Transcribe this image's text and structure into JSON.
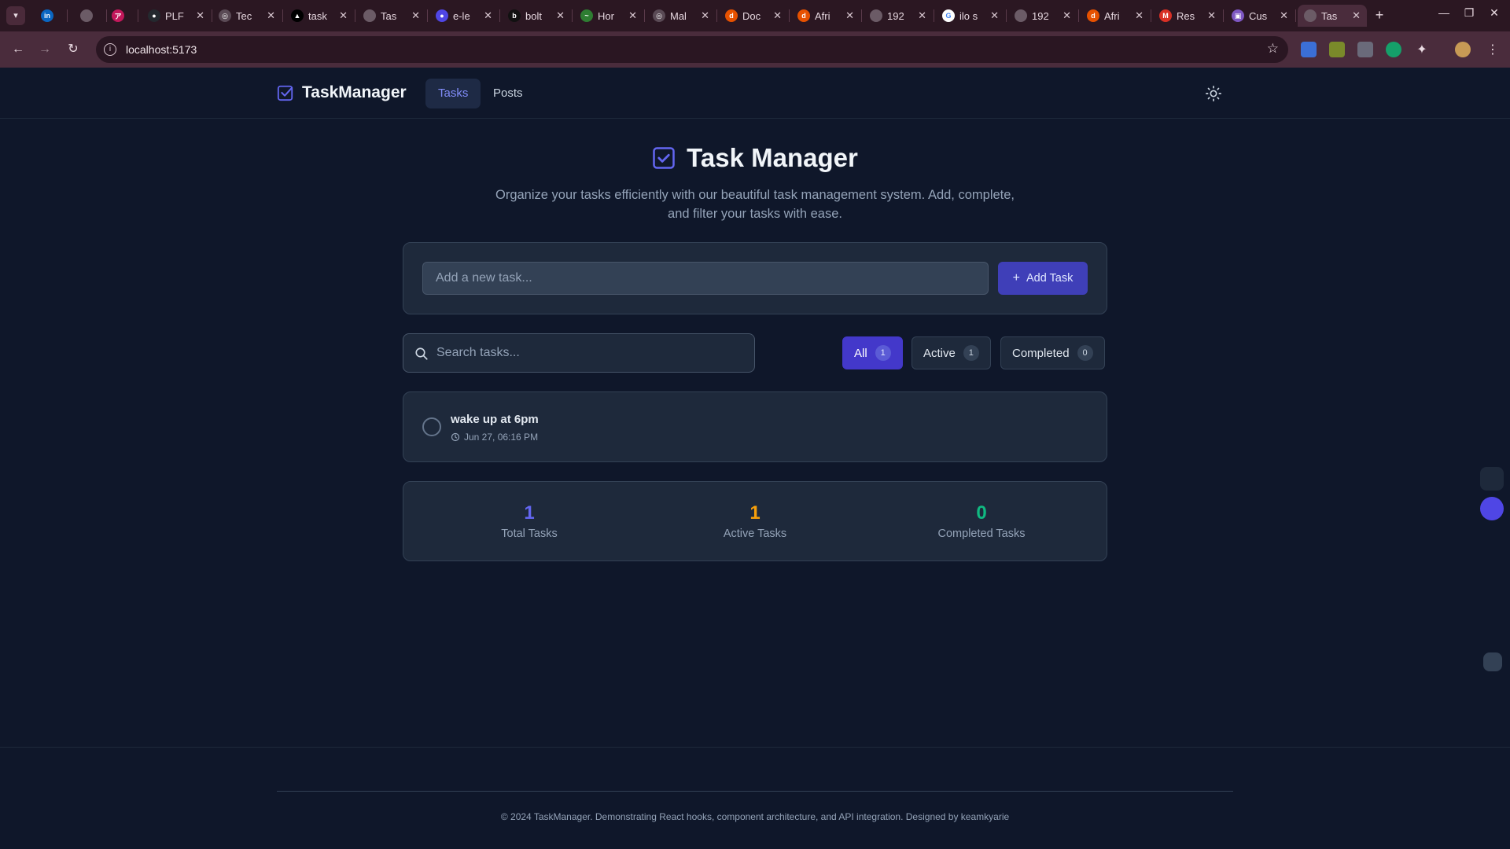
{
  "browser": {
    "tabs": [
      {
        "title": "",
        "fav_color": "#0a66c2",
        "fav_text": "in"
      },
      {
        "title": "",
        "fav_color": "#6b5b66",
        "fav_text": ""
      },
      {
        "title": "",
        "fav_color": "#c2185b",
        "fav_text": "ア"
      },
      {
        "title": "PLF",
        "fav_color": "#24292f",
        "fav_text": "●"
      },
      {
        "title": "Tec",
        "fav_color": "#5a4a55",
        "fav_text": "◎"
      },
      {
        "title": "task",
        "fav_color": "#000000",
        "fav_text": "▲"
      },
      {
        "title": "Tas",
        "fav_color": "#6b5b66",
        "fav_text": ""
      },
      {
        "title": "e-le",
        "fav_color": "#4f46e5",
        "fav_text": "●"
      },
      {
        "title": "bolt",
        "fav_color": "#111111",
        "fav_text": "b"
      },
      {
        "title": "Hor",
        "fav_color": "#2e7d32",
        "fav_text": "~"
      },
      {
        "title": "Mal",
        "fav_color": "#5a4a55",
        "fav_text": "◎"
      },
      {
        "title": "Doc",
        "fav_color": "#e65100",
        "fav_text": "d"
      },
      {
        "title": "Afri",
        "fav_color": "#e65100",
        "fav_text": "d"
      },
      {
        "title": "192",
        "fav_color": "#6b5b66",
        "fav_text": ""
      },
      {
        "title": "ilo s",
        "fav_color": "#ffffff",
        "fav_text": "G"
      },
      {
        "title": "192",
        "fav_color": "#6b5b66",
        "fav_text": ""
      },
      {
        "title": "Afri",
        "fav_color": "#e65100",
        "fav_text": "d"
      },
      {
        "title": "Res",
        "fav_color": "#d93025",
        "fav_text": "M"
      },
      {
        "title": "Cus",
        "fav_color": "#7e57c2",
        "fav_text": "▣"
      },
      {
        "title": "Tas",
        "fav_color": "#6b5b66",
        "fav_text": "",
        "active": true
      }
    ],
    "url": "localhost:5173"
  },
  "app": {
    "brand": "TaskManager",
    "nav": {
      "tasks": "Tasks",
      "posts": "Posts"
    },
    "hero": {
      "title": "Task Manager",
      "description": "Organize your tasks efficiently with our beautiful task management system. Add, complete, and filter your tasks with ease."
    },
    "add": {
      "placeholder": "Add a new task...",
      "button": "Add Task"
    },
    "search": {
      "placeholder": "Search tasks..."
    },
    "filters": {
      "all": {
        "label": "All",
        "count": "1"
      },
      "active": {
        "label": "Active",
        "count": "1"
      },
      "completed": {
        "label": "Completed",
        "count": "0"
      }
    },
    "tasks": [
      {
        "title": "wake up at 6pm",
        "time": "Jun 27, 06:16 PM",
        "completed": false
      }
    ],
    "stats": {
      "total": {
        "value": "1",
        "label": "Total Tasks",
        "color": "#6366f1"
      },
      "active": {
        "value": "1",
        "label": "Active Tasks",
        "color": "#f59e0b"
      },
      "completed": {
        "value": "0",
        "label": "Completed Tasks",
        "color": "#10b981"
      }
    },
    "footer": "© 2024 TaskManager. Demonstrating React hooks, component architecture, and API integration. Designed by keamkyarie"
  },
  "colors": {
    "accent": "#4f46e5",
    "background": "#0f172a",
    "card": "#1e293b"
  }
}
